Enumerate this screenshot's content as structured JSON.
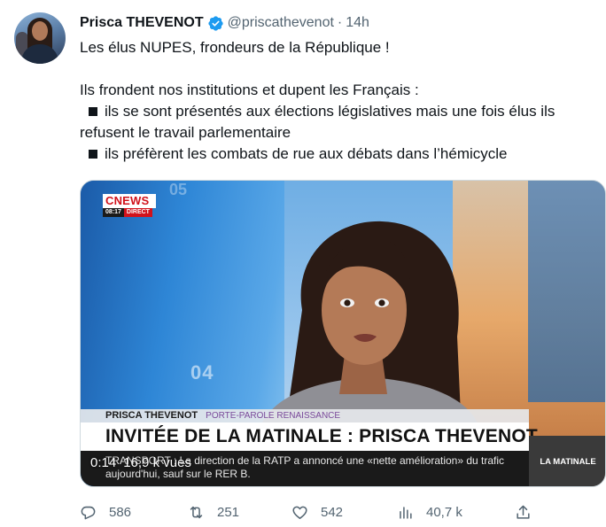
{
  "author": {
    "name": "Prisca THEVENOT",
    "handle": "@priscathevenot",
    "separator": "·",
    "time": "14h",
    "verified_color": "#1d9bf0"
  },
  "tweet": {
    "line1": "Les élus NUPES, frondeurs de la République !",
    "line2": "Ils frondent nos institutions et dupent les Français :",
    "bullet1_a": "ils se sont présentés aux élections législatives mais une fois élus ils",
    "bullet1_b": "refusent le travail parlementaire",
    "bullet2": "ils préfèrent les combats de rue aux débats dans l’hémicycle"
  },
  "video": {
    "channel_logo": "CNEWS",
    "clock": "08:17",
    "live_label": "DIRECT",
    "guest_name": "PRISCA THEVENOT",
    "guest_role": "PORTE-PAROLE RENAISSANCE",
    "title": "INVITÉE DE LA MATINALE : PRISCA THEVENOT",
    "ticker": "TRANSPORT : La direction de la RATP a annoncé une «nette amélioration» du trafic aujourd'hui, sauf sur le RER B.",
    "program": "LA MATINALE",
    "backdrop_num_1": "04",
    "backdrop_num_2": "05",
    "elapsed": "0:14",
    "views": "16,9 k vues"
  },
  "actions": {
    "replies": "586",
    "retweets": "251",
    "likes": "542",
    "views": "40,7 k"
  }
}
